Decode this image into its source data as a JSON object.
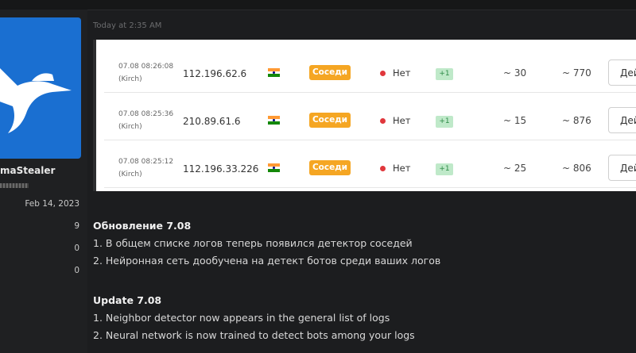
{
  "post": {
    "timestamp": "Today at 2:35 AM"
  },
  "user": {
    "name": "maStealer",
    "join_date": "Feb 14, 2023",
    "stats": [
      "9",
      "0",
      "0"
    ]
  },
  "screenshot_table": {
    "rows": [
      {
        "date": "07.08 08:26:08",
        "tz": "(Kirch)",
        "ip": "112.196.62.6",
        "flag": "india-flag-icon",
        "neighbors": "Соседи",
        "status": "Нет",
        "plus": "+1",
        "v1": "~ 30",
        "v2": "~ 770",
        "action": "Дей"
      },
      {
        "date": "07.08 08:25:36",
        "tz": "(Kirch)",
        "ip": "210.89.61.6",
        "flag": "india-flag-icon",
        "neighbors": "Соседи",
        "status": "Нет",
        "plus": "+1",
        "v1": "~ 15",
        "v2": "~ 876",
        "action": "Дей"
      },
      {
        "date": "07.08 08:25:12",
        "tz": "(Kirch)",
        "ip": "112.196.33.226",
        "flag": "india-flag-icon",
        "neighbors": "Соседи",
        "status": "Нет",
        "plus": "+1",
        "v1": "~ 25",
        "v2": "~ 806",
        "action": "Дей"
      }
    ]
  },
  "content": {
    "ru_title": "Обновление 7.08",
    "ru_items": [
      "1. В общем списке логов теперь появился детектор соседей",
      "2. Нейронная сеть дообучена на детект ботов среди ваших логов"
    ],
    "en_title": "Update 7.08",
    "en_items": [
      "1. Neighbor detector now appears in the general list of logs",
      "2. Neural network is now trained to detect bots among your logs"
    ]
  },
  "colors": {
    "page_bg": "#1c1d1f",
    "avatar_bg": "#1a6fd1",
    "neighbors_badge": "#f5a623",
    "status_dot": "#e0373c",
    "plus_badge_bg": "#bfe9c9"
  }
}
